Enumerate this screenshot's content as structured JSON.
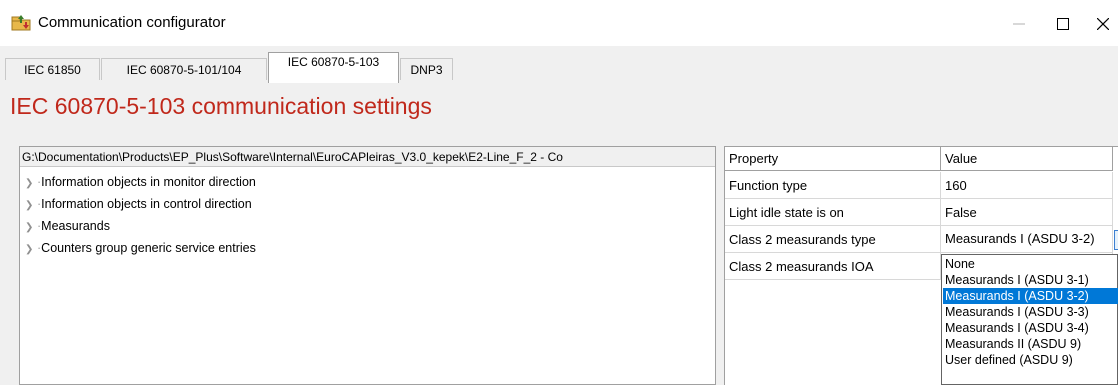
{
  "window": {
    "title": "Communication configurator"
  },
  "tabs": [
    {
      "label": "IEC 61850"
    },
    {
      "label": "IEC 60870-5-101/104"
    },
    {
      "label": "IEC 60870-5-103"
    },
    {
      "label": "DNP3"
    }
  ],
  "page": {
    "title": "IEC 60870-5-103 communication settings"
  },
  "tree": {
    "path": "G:\\Documentation\\Products\\EP_Plus\\Software\\Internal\\EuroCAPleiras_V3.0_kepek\\E2-Line_F_2 - Co",
    "items": [
      "Information objects in monitor direction",
      "Information objects in control direction",
      "Measurands",
      "Counters group generic service entries"
    ]
  },
  "grid": {
    "headers": {
      "property": "Property",
      "value": "Value"
    },
    "rows": [
      {
        "property": "Function type",
        "value": "160"
      },
      {
        "property": "Light idle state is on",
        "value": "False"
      },
      {
        "property": "Class 2 measurands type",
        "value": "Measurands I (ASDU 3-2)"
      },
      {
        "property": "Class 2 measurands IOA",
        "value": ""
      }
    ]
  },
  "dropdown": {
    "options": [
      "None",
      "Measurands I (ASDU 3-1)",
      "Measurands I (ASDU 3-2)",
      "Measurands I (ASDU 3-3)",
      "Measurands I (ASDU 3-4)",
      "Measurands II (ASDU 9)",
      "User defined (ASDU 9)"
    ],
    "selected": "Measurands I (ASDU 3-2)"
  },
  "colors": {
    "title_red": "#c0281b",
    "selection_blue": "#0078d7",
    "accent_blue": "#3c7fd1"
  }
}
